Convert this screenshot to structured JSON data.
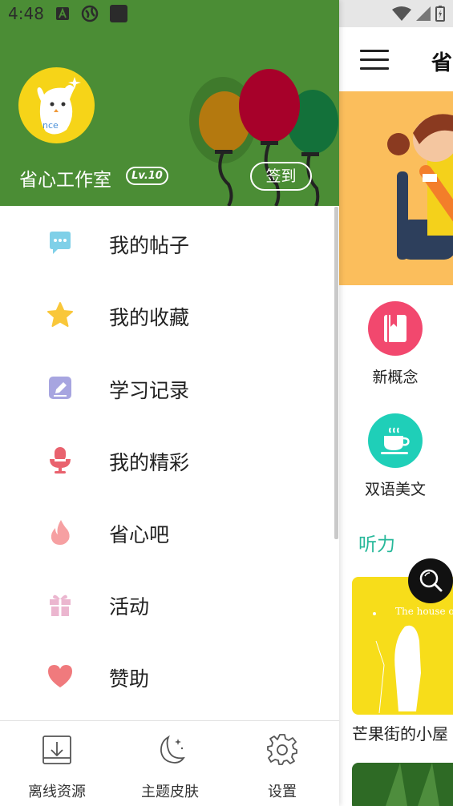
{
  "status_bar": {
    "time": "4:48"
  },
  "header": {
    "user_name": "省心工作室",
    "level": "Lv.10",
    "checkin_label": "签到"
  },
  "menu": {
    "items": [
      {
        "label": "我的帖子",
        "icon": "chat-bubble-icon",
        "color": "#7fd0e8"
      },
      {
        "label": "我的收藏",
        "icon": "star-icon",
        "color": "#f9c73a"
      },
      {
        "label": "学习记录",
        "icon": "edit-note-icon",
        "color": "#a7a5e0"
      },
      {
        "label": "我的精彩",
        "icon": "microphone-icon",
        "color": "#e9626e"
      },
      {
        "label": "省心吧",
        "icon": "flame-icon",
        "color": "#f6a0a2"
      },
      {
        "label": "活动",
        "icon": "gift-icon",
        "color": "#ebb6cf"
      },
      {
        "label": "赞助",
        "icon": "heart-icon",
        "color": "#f07a7d"
      }
    ]
  },
  "bottom_bar": {
    "items": [
      {
        "label": "离线资源",
        "icon": "download-icon"
      },
      {
        "label": "主题皮肤",
        "icon": "moon-icon"
      },
      {
        "label": "设置",
        "icon": "gear-icon"
      }
    ]
  },
  "background_page": {
    "title": "省",
    "categories": [
      {
        "label": "新概念",
        "icon": "book-icon",
        "color": "#f2486e"
      },
      {
        "label": "双语美文",
        "icon": "coffee-cup-icon",
        "color": "#1fcfb8"
      }
    ],
    "section_title": "听力",
    "card_caption": "芒果街的小屋",
    "card_cover_text": "The house on M"
  },
  "colors": {
    "header_green": "#4b8d35",
    "accent_teal": "#27b89a"
  }
}
